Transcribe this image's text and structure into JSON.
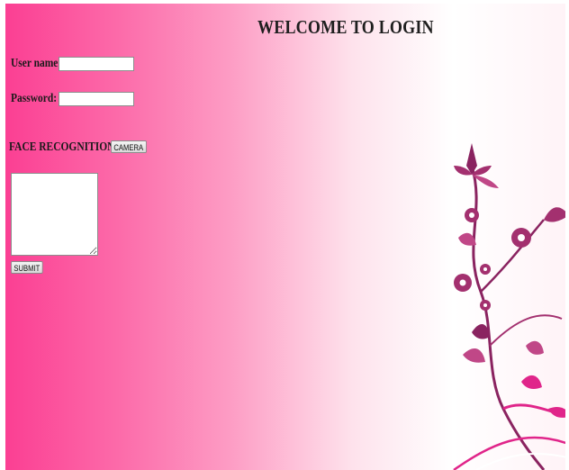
{
  "page": {
    "title": "WELCOME TO LOGIN"
  },
  "form": {
    "username_label": "User name:",
    "username_value": "",
    "password_label": "Password:",
    "password_value": "",
    "face_label": "FACE RECOGNITION:",
    "camera_button": "CAMERA",
    "notes_value": "",
    "submit_button": "SUBMIT"
  },
  "colors": {
    "gradient_left": "#fb3f93",
    "gradient_right": "#ffffff",
    "floral_dark": "#8a2360",
    "floral_bright": "#e0258a"
  },
  "decor": {
    "icon": "floral-vine-icon"
  }
}
